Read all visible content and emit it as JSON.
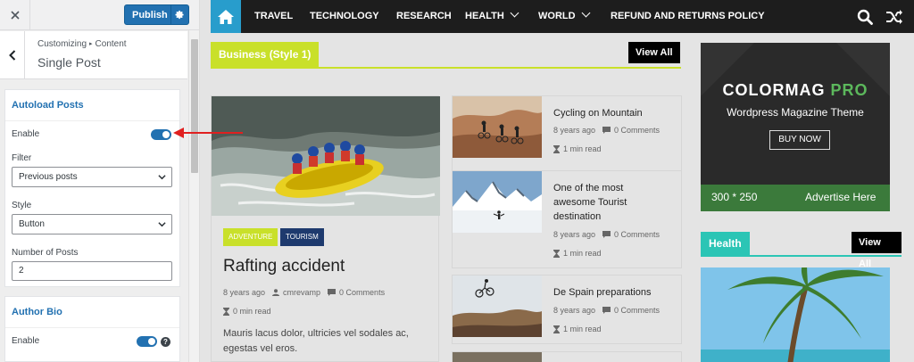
{
  "customizer": {
    "publish_label": "Publish",
    "breadcrumb_parent": "Customizing",
    "breadcrumb_child": "Content",
    "section_title": "Single Post",
    "autoload": {
      "title": "Autoload Posts",
      "enable_label": "Enable",
      "enable_on": true,
      "filter_label": "Filter",
      "filter_value": "Previous posts",
      "style_label": "Style",
      "style_value": "Button",
      "number_label": "Number of Posts",
      "number_value": "2"
    },
    "author_bio": {
      "title": "Author Bio",
      "enable_label": "Enable",
      "enable_on": true
    }
  },
  "site": {
    "nav": {
      "items": [
        {
          "label": "TRAVEL"
        },
        {
          "label": "TECHNOLOGY"
        },
        {
          "label": "RESEARCH"
        },
        {
          "label": "HEALTH"
        },
        {
          "label": "WORLD"
        },
        {
          "label": "REFUND AND RETURNS POLICY"
        }
      ]
    },
    "business": {
      "label": "Business (Style 1)",
      "view_all": "View All"
    },
    "featured": {
      "tags": [
        "ADVENTURE",
        "TOURISM"
      ],
      "title": "Rafting accident",
      "date": "8 years ago",
      "author": "cmrevamp",
      "comments": "0 Comments",
      "read": "0 min read",
      "excerpt": "Mauris lacus dolor, ultricies vel sodales ac, egestas vel eros."
    },
    "side_posts": [
      {
        "title": "Cycling on Mountain",
        "date": "8 years ago",
        "comments": "0 Comments",
        "read": "1 min read"
      },
      {
        "title": "One of the most awesome Tourist destination",
        "date": "8 years ago",
        "comments": "0 Comments",
        "read": "1 min read"
      },
      {
        "title": "De Spain preparations",
        "date": "8 years ago",
        "comments": "0 Comments",
        "read": "1 min read"
      }
    ],
    "ad": {
      "title_main": "COLORMAG",
      "title_pro": "PRO",
      "subtitle": "Wordpress Magazine Theme",
      "button": "BUY NOW",
      "size": "300 * 250",
      "advertise": "Advertise Here"
    },
    "health": {
      "label": "Health",
      "view_all": "View All"
    }
  },
  "colors": {
    "accent_blue": "#2271b1",
    "business": "#c9e02a",
    "health": "#2bc5b5",
    "tag_adventure": "#c9e02a",
    "tag_tourism": "#1e3a6e",
    "annotation_arrow": "#e02020"
  }
}
